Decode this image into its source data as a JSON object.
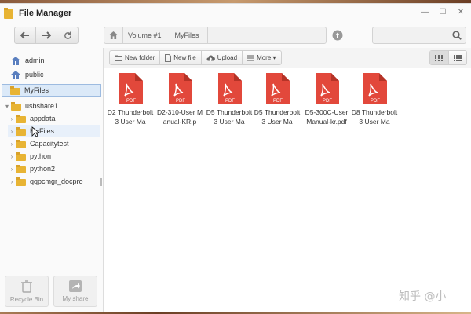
{
  "window": {
    "title": "File Manager"
  },
  "toolbar": {
    "back_icon": "arrow-left-icon",
    "forward_icon": "arrow-right-icon",
    "refresh_icon": "refresh-icon",
    "home_icon": "home-icon",
    "breadcrumbs": [
      "Volume #1",
      "MyFiles"
    ],
    "up_icon": "up-circle-icon",
    "search": {
      "value": "",
      "placeholder": ""
    }
  },
  "sidebar": {
    "items": [
      {
        "label": "admin",
        "icon": "user-home-icon"
      },
      {
        "label": "public",
        "icon": "user-home-icon"
      },
      {
        "label": "MyFiles",
        "icon": "folder-icon",
        "selected": true
      },
      {
        "label": "usbshare1",
        "icon": "folder-icon",
        "expanded": true
      },
      {
        "label": "appdata",
        "icon": "folder-icon"
      },
      {
        "label": "MyFiles",
        "icon": "folder-icon",
        "hover": true
      },
      {
        "label": "Capacitytest",
        "icon": "folder-icon"
      },
      {
        "label": "python",
        "icon": "folder-icon"
      },
      {
        "label": "python2",
        "icon": "folder-icon"
      },
      {
        "label": "qqpcmgr_docpro",
        "icon": "folder-icon"
      }
    ],
    "recycle_bin": "Recycle Bin",
    "my_share": "My share"
  },
  "actions": {
    "new_folder": "New folder",
    "new_file": "New file",
    "upload": "Upload",
    "more": "More ▾"
  },
  "files": [
    {
      "name": "D2 Thunderbolt3 User Ma",
      "type": "PDF"
    },
    {
      "name": "D2-310-User Manual-KR.p",
      "type": "PDF"
    },
    {
      "name": "D5 Thunderbolt3 User Ma",
      "type": "PDF"
    },
    {
      "name": "D5 Thunderbolt3 User Ma",
      "type": "PDF"
    },
    {
      "name": "D5-300C-User Manual-kr.pdf",
      "type": "PDF"
    },
    {
      "name": "D8 Thunderbolt 3 User Ma",
      "type": "PDF"
    }
  ],
  "watermark": "知乎 @小",
  "colors": {
    "pdf_red": "#e2483b",
    "pdf_dark": "#b53327",
    "folder": "#e8b434",
    "selected": "#dbe9f8"
  }
}
